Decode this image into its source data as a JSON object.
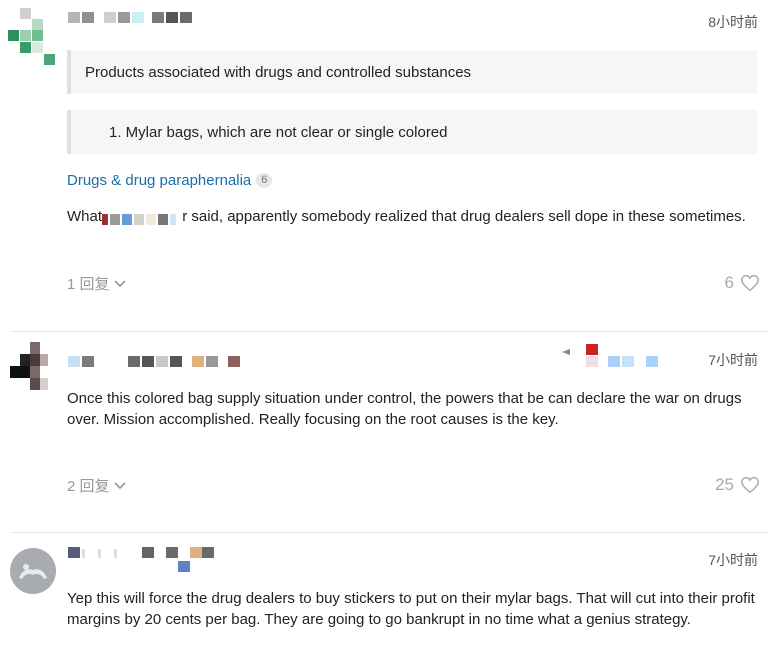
{
  "comments": [
    {
      "timestamp": "8小时前",
      "quote_1": "Products associated with drugs and controlled substances",
      "quote_2": "1. Mylar bags, which are not clear or single colored",
      "link_label": "Drugs & drug paraphernalia",
      "link_count": "6",
      "body_prefix": "What",
      "body_suffix": "r said, apparently somebody realized that drug dealers sell dope in these sometimes.",
      "reply_label": "1 回复",
      "like_count": "6"
    },
    {
      "timestamp": "7小时前",
      "body": "Once this colored bag supply situation under control, the powers that be can declare the war on drugs over. Mission accomplished. Really focusing on the root causes is the key.",
      "reply_label": "2 回复",
      "like_count": "25"
    },
    {
      "timestamp": "7小时前",
      "body": "Yep this will force the drug dealers to buy stickers to put on their mylar bags. That will cut into their profit margins by 20 cents per bag. They are going to go bankrupt in no time what a genius strategy."
    }
  ],
  "icons": {
    "chevron": "chevron-down-icon",
    "heart": "heart-icon",
    "avatar_default": "default-avatar-icon"
  },
  "colors": {
    "link": "#1a6ea8",
    "muted": "#999999",
    "quote_bg": "#f6f6f6"
  }
}
